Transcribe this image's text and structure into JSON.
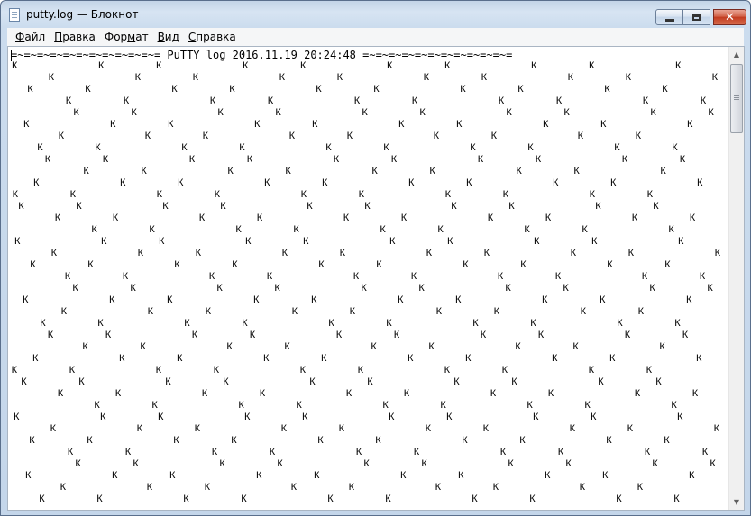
{
  "window": {
    "title": "putty.log — Блокнот"
  },
  "menu": [
    {
      "key": "Ф",
      "rest": "айл"
    },
    {
      "key": "П",
      "rest": "равка"
    },
    {
      "key": "Фор",
      "rest": "мат",
      "pre": "",
      "mid": ""
    },
    {
      "key": "В",
      "rest": "ид"
    },
    {
      "key": "С",
      "rest": "правка"
    }
  ],
  "menu_labels": [
    "Файл",
    "Правка",
    "Формат",
    "Вид",
    "Справка"
  ],
  "editor": {
    "header_line": "=~=~=~=~=~=~=~=~=~=~=~= PuTTY log 2016.11.19 20:24:48 =~=~=~=~=~=~=~=~=~=~=~=",
    "glyph_char": "К"
  },
  "icons": {
    "app": "notepad-icon",
    "minimize": "minimize-icon",
    "maximize": "maximize-icon",
    "close": "close-icon",
    "scroll_up": "arrow-up-icon",
    "scroll_down": "arrow-down-icon"
  },
  "scroll": {
    "position_fraction": 0.0,
    "visible_fraction": 0.16
  }
}
